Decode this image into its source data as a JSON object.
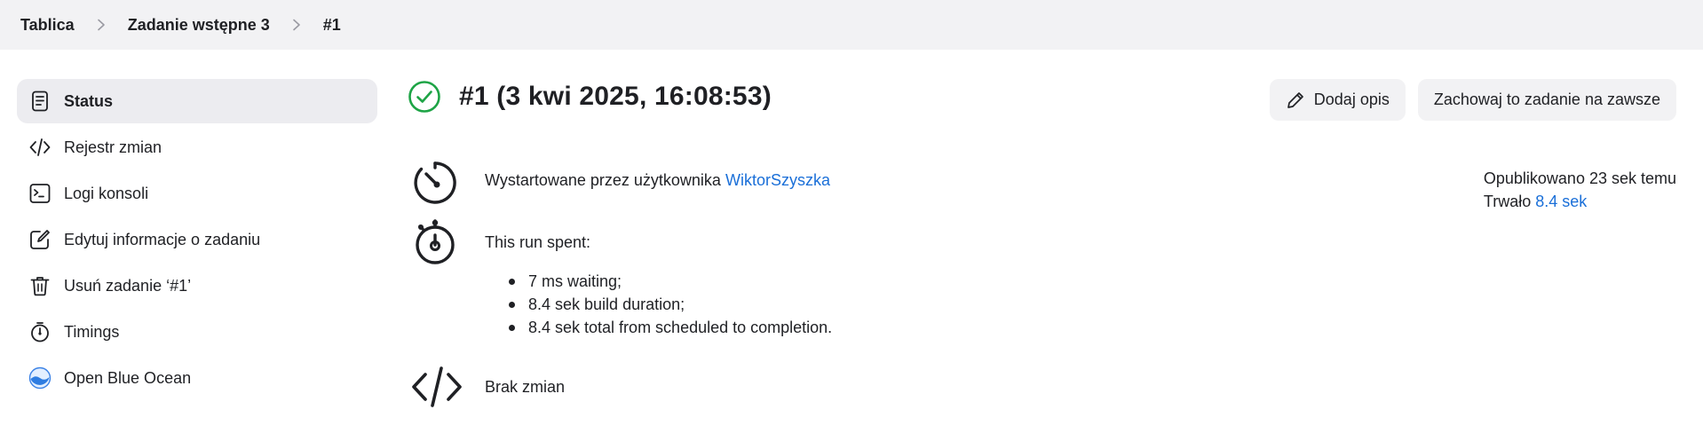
{
  "breadcrumb": {
    "items": [
      "Tablica",
      "Zadanie wstępne 3",
      "#1"
    ]
  },
  "sidebar": {
    "items": [
      {
        "label": "Status",
        "icon": "status-document-icon",
        "active": true
      },
      {
        "label": "Rejestr zmian",
        "icon": "code-icon"
      },
      {
        "label": "Logi konsoli",
        "icon": "terminal-icon"
      },
      {
        "label": "Edytuj informacje o zadaniu",
        "icon": "edit-icon"
      },
      {
        "label": "Usuń zadanie ‘#1’",
        "icon": "trash-icon"
      },
      {
        "label": "Timings",
        "icon": "stopwatch-icon"
      },
      {
        "label": "Open Blue Ocean",
        "icon": "blue-ocean-icon"
      }
    ]
  },
  "build": {
    "title": "#1 (3 kwi 2025, 16:08:53)",
    "status": "success",
    "status_color": "#1ea446"
  },
  "actions": {
    "add_description": "Dodaj opis",
    "keep_forever": "Zachowaj to zadanie na zawsze"
  },
  "started": {
    "prefix": "Wystartowane przez użytkownika ",
    "user": "WiktorSzyszka"
  },
  "run": {
    "heading": "This run spent:",
    "items": [
      "7 ms waiting;",
      "8.4 sek build duration;",
      "8.4 sek total from scheduled to completion."
    ]
  },
  "changes": {
    "label": "Brak zmian"
  },
  "meta": {
    "published": "Opublikowano 23 sek temu",
    "duration_prefix": "Trwało ",
    "duration": "8.4 sek"
  },
  "colors": {
    "accent_link": "#1a6fd8",
    "success": "#1ea446",
    "header_bg": "#f2f2f4"
  }
}
